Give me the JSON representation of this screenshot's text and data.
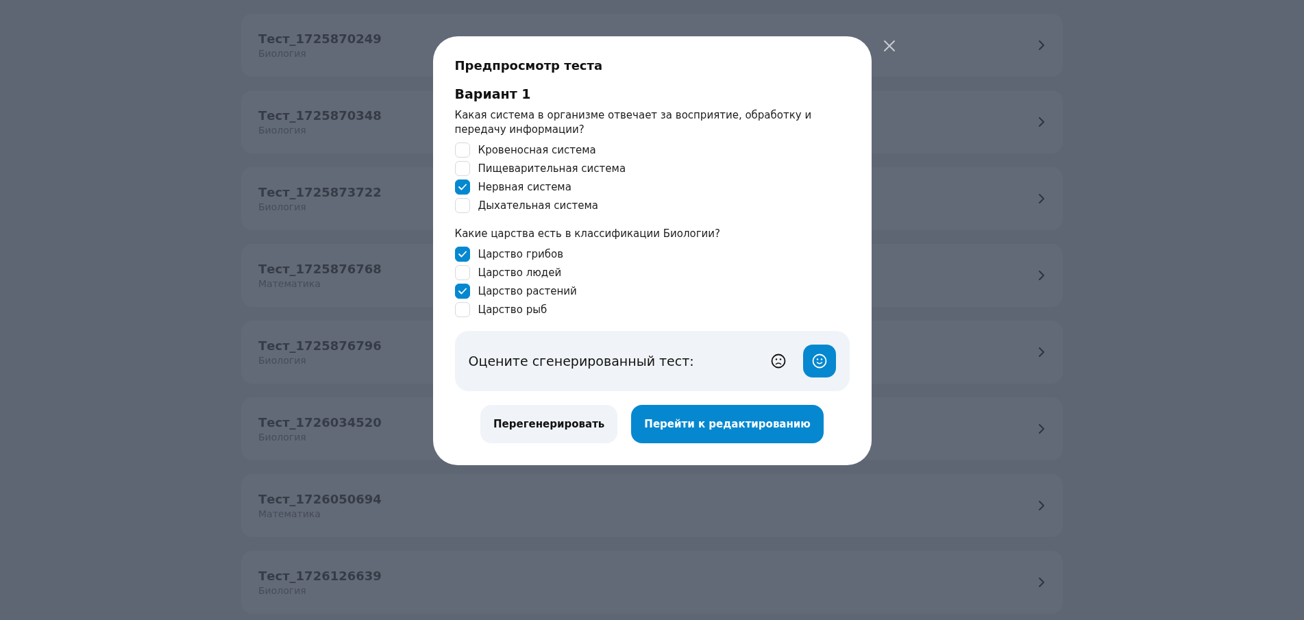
{
  "tests": [
    {
      "title": "Тест_1725870249",
      "subject": "Биология"
    },
    {
      "title": "Тест_1725870348",
      "subject": "Биология"
    },
    {
      "title": "Тест_1725873722",
      "subject": "Биология"
    },
    {
      "title": "Тест_1725876768",
      "subject": "Математика"
    },
    {
      "title": "Тест_1725876796",
      "subject": "Биология"
    },
    {
      "title": "Тест_1726034520",
      "subject": "Биология"
    },
    {
      "title": "Тест_1726050694",
      "subject": "Математика"
    },
    {
      "title": "Тест_1726126639",
      "subject": "Биология"
    }
  ],
  "dialog": {
    "title": "Предпросмотр теста",
    "variant": "Вариант 1",
    "questions": [
      {
        "text": "Какая система в организме отвечает за восприятие, обработку и передачу информации?",
        "options": [
          {
            "label": "Кровеносная система",
            "checked": false
          },
          {
            "label": "Пищеварительная система",
            "checked": false
          },
          {
            "label": "Нервная система",
            "checked": true
          },
          {
            "label": "Дыхательная система",
            "checked": false
          }
        ]
      },
      {
        "text": "Какие царства есть в классификации Биологии?",
        "options": [
          {
            "label": "Царство грибов",
            "checked": true
          },
          {
            "label": "Царство людей",
            "checked": false
          },
          {
            "label": "Царство растений",
            "checked": true
          },
          {
            "label": "Царство рыб",
            "checked": false
          }
        ]
      }
    ],
    "rating": {
      "prompt": "Оцените сгенерированный тест:",
      "options": [
        {
          "kind": "sad",
          "selected": false
        },
        {
          "kind": "happy",
          "selected": true
        }
      ]
    },
    "buttons": [
      {
        "label": "Перегенерировать",
        "kind": "secondary"
      },
      {
        "label": "Перейти к редактированию",
        "kind": "primary"
      }
    ]
  }
}
